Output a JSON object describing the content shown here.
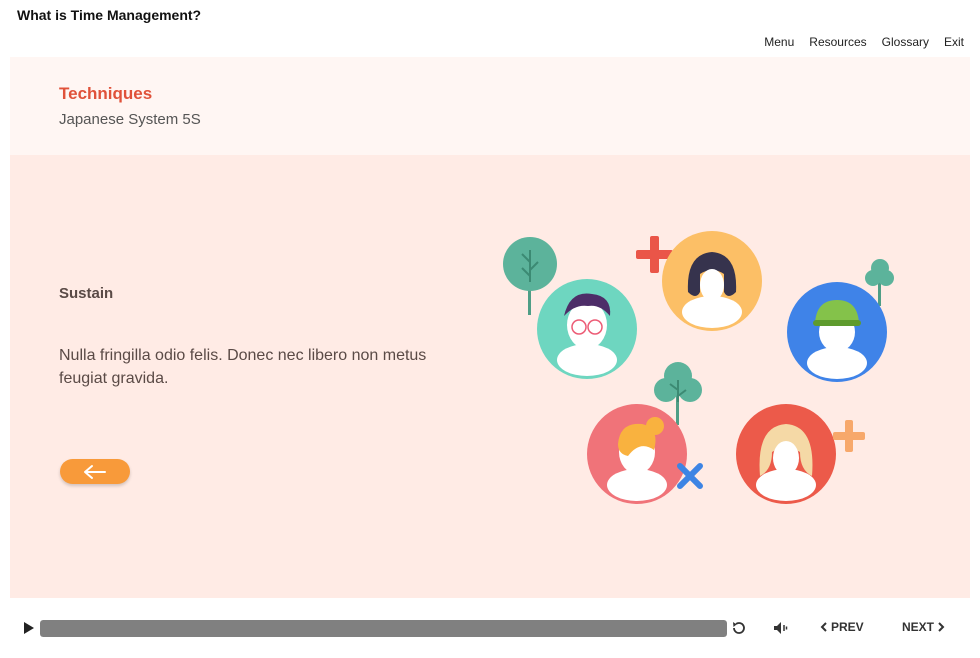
{
  "course": {
    "title": "What is Time Management?"
  },
  "nav": {
    "menu": "Menu",
    "resources": "Resources",
    "glossary": "Glossary",
    "exit": "Exit"
  },
  "section": {
    "title": "Techniques",
    "subtitle": "Japanese System 5S"
  },
  "content": {
    "heading": "Sustain",
    "body": "Nulla fringilla odio felis. Donec nec libero non metus feugiat gravida."
  },
  "illustration": {
    "icons": [
      "tree-icon",
      "person-glasses-icon",
      "plus-icon",
      "person-long-hair-icon",
      "person-green-hat-icon",
      "person-bun-icon",
      "cross-icon",
      "person-blonde-icon"
    ]
  },
  "player": {
    "progress_percent": 100,
    "prev_label": "PREV",
    "next_label": "NEXT"
  },
  "colors": {
    "accent": "#e0523a",
    "button": "#f89a3a",
    "content_bg": "#ffebe5",
    "header_bg": "#fff6f3",
    "progress": "#808080"
  }
}
